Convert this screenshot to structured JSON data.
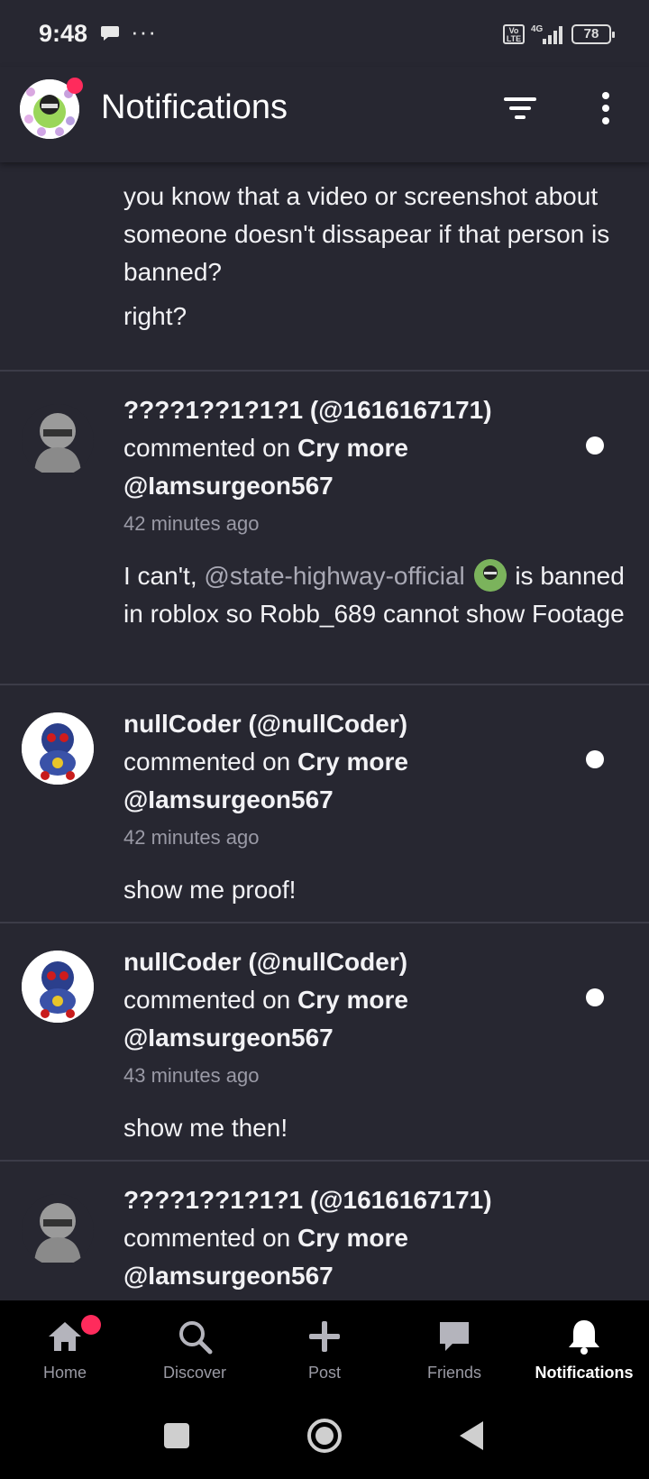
{
  "status_bar": {
    "time": "9:48",
    "dots": "···",
    "volte": "Vo LTE",
    "network": "4G",
    "battery": "78"
  },
  "app_bar": {
    "title": "Notifications"
  },
  "top_comment": {
    "paragraph1": "you know that a video or screenshot about someone doesn't dissapear if that person is banned?",
    "paragraph2": "right?"
  },
  "notifications": [
    {
      "user": "????1??1?1?1 (@1616167171)",
      "action": "commented on",
      "post": "Cry more @Iamsurgeon567",
      "time": "42 minutes ago",
      "body_before": "I can't,",
      "mention": "@state-highway-official",
      "body_after": "is banned in roblox so Robb_689 cannot show Footage",
      "unread": true
    },
    {
      "user": "nullCoder (@nullCoder)",
      "action": "commented on",
      "post": "Cry more @Iamsurgeon567",
      "time": "42 minutes ago",
      "body": "show me proof!",
      "unread": true
    },
    {
      "user": "nullCoder (@nullCoder)",
      "action": "commented on",
      "post": "Cry more @Iamsurgeon567",
      "time": "43 minutes ago",
      "body": "show me then!",
      "unread": true
    },
    {
      "user": "????1??1?1?1 (@1616167171)",
      "action": "commented on",
      "post": "Cry more @Iamsurgeon567"
    }
  ],
  "bottom_nav": {
    "items": [
      {
        "label": "Home",
        "icon": "home-icon"
      },
      {
        "label": "Discover",
        "icon": "search-icon"
      },
      {
        "label": "Post",
        "icon": "plus-icon"
      },
      {
        "label": "Friends",
        "icon": "chat-icon"
      },
      {
        "label": "Notifications",
        "icon": "bell-icon"
      }
    ],
    "active": "Notifications"
  },
  "colors": {
    "background": "#272731",
    "divider": "#3c3c48",
    "badge": "#ff2b5c",
    "nav_background": "#000000"
  }
}
